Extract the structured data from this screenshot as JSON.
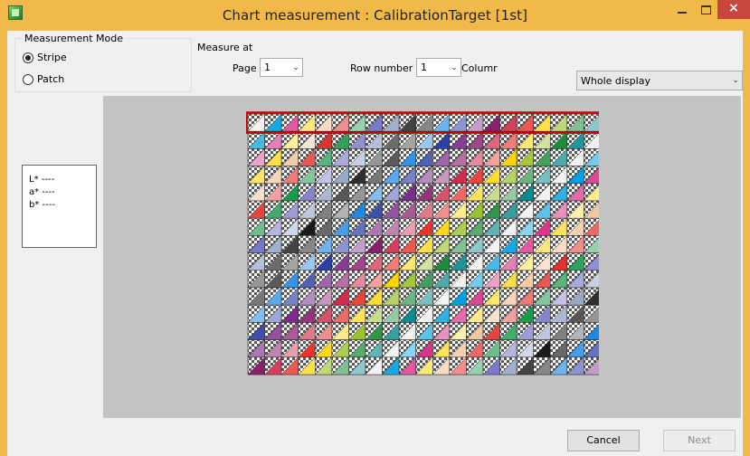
{
  "window": {
    "title": "Chart measurement : CalibrationTarget [1st]",
    "close_glyph": "×",
    "accent_color": "#f0b94a",
    "close_color": "#c9463d"
  },
  "measurement_mode": {
    "label": "Measurement Mode",
    "options": [
      "Stripe",
      "Patch"
    ],
    "selected": "Stripe"
  },
  "measure_at": {
    "label": "Measure at",
    "page_label": "Page",
    "page_value": "1",
    "row_label": "Row number",
    "row_value": "1",
    "column_label": "Columr"
  },
  "view_select": {
    "value": "Whole display"
  },
  "lab": {
    "l": "L* ----",
    "a": "a* ----",
    "b": "b* ----"
  },
  "chart_grid": {
    "rows": 15,
    "columns": 21,
    "selected_row": 1,
    "highlight_color": "#cc0000"
  },
  "buttons": {
    "cancel": "Cancel",
    "next": "Next"
  }
}
